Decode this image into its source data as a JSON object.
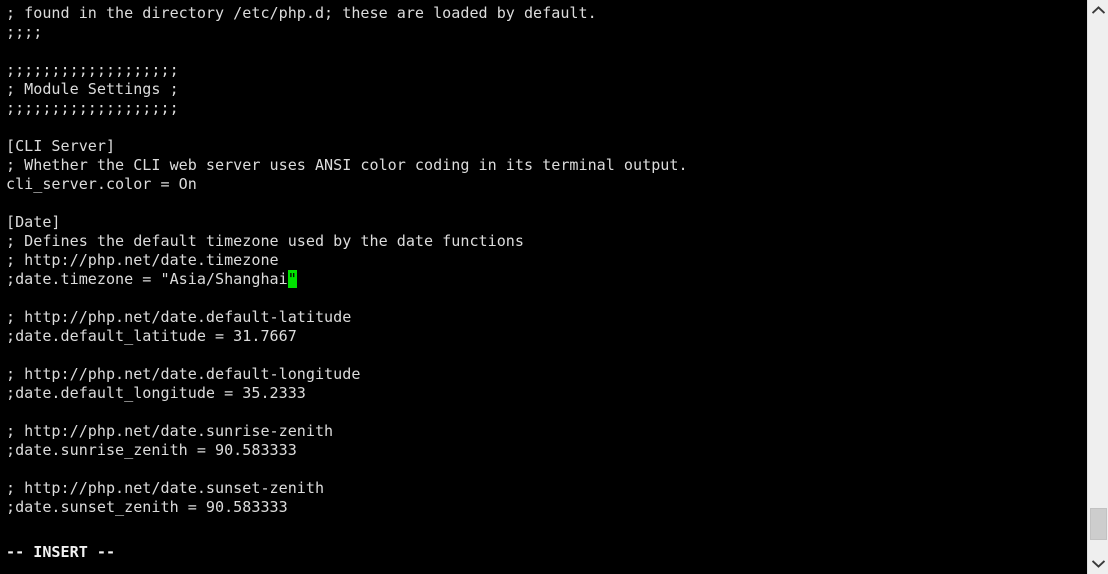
{
  "editor": {
    "name": "vim",
    "mode_label": "-- INSERT --",
    "background_color": "#000000",
    "text_color": "#dcdcdc",
    "cursor_color": "#00e000",
    "lines": [
      "; found in the directory /etc/php.d; these are loaded by default.",
      ";;;;",
      "",
      ";;;;;;;;;;;;;;;;;;;",
      "; Module Settings ;",
      ";;;;;;;;;;;;;;;;;;;",
      "",
      "[CLI Server]",
      "; Whether the CLI web server uses ANSI color coding in its terminal output.",
      "cli_server.color = On",
      "",
      "[Date]",
      "; Defines the default timezone used by the date functions",
      "; http://php.net/date.timezone",
      "",
      "",
      "; http://php.net/date.default-latitude",
      ";date.default_latitude = 31.7667",
      "",
      "; http://php.net/date.default-longitude",
      ";date.default_longitude = 35.2333",
      "",
      "; http://php.net/date.sunrise-zenith",
      ";date.sunrise_zenith = 90.583333",
      "",
      "; http://php.net/date.sunset-zenith",
      ";date.sunset_zenith = 90.583333",
      "",
      ""
    ],
    "cursor_line": {
      "index": 14,
      "before": ";date.timezone = \"Asia/Shanghai",
      "cursor_char": "\"",
      "after": ""
    }
  },
  "scrollbar": {
    "up_arrow": "chevron-up",
    "down_arrow": "chevron-down",
    "thumb_position_percent": 92,
    "track_color": "#efefef",
    "thumb_color": "#cdcdcd"
  }
}
